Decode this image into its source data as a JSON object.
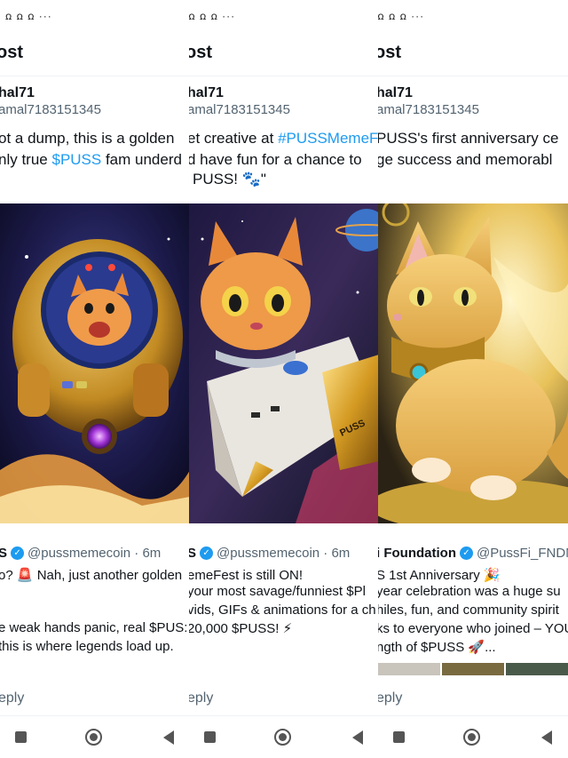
{
  "panels": [
    {
      "status_icons": "ꭥ ꭥ ꭥ ···",
      "header_title": "ost",
      "name": "hal71",
      "handle": "amal7183151345",
      "body_lines": [
        "ot a dump, this is a golden",
        "nly true ",
        "$PUSS",
        " fam underd"
      ],
      "quote_name": "S",
      "quote_handle": "@pussmemecoin · 6m",
      "quote_lines": [
        "o? 🚨 Nah, just another golden",
        "e weak hands panic,  real $PUS:",
        "this is where legends load up."
      ],
      "reply": "eply"
    },
    {
      "status_icons": "✱ ꭥ ꭥ ꭥ ···",
      "header_title": "ost",
      "name": "hal71",
      "handle": "amal7183151345",
      "body_lines": [
        "et creative at ",
        "#PUSSMemeF",
        "d have fun for a chance to",
        "PUSS! 🐾\""
      ],
      "quote_name": "S",
      "quote_handle": "@pussmemecoin · 6m",
      "quote_lines": [
        "emeFest is still ON!",
        "your most savage/funniest $Pl",
        "vids, GIFs & animations for a ch",
        "20,000 $PUSS! ⚡"
      ],
      "reply": "eply"
    },
    {
      "status_icons": "✱ ꭥ ꭥ ꭥ ···",
      "header_title": "ost",
      "name": "hal71",
      "handle": "amal7183151345",
      "body_lines": [
        "PUSS's first anniversary ce",
        "ge success and memorabl"
      ],
      "quote_name": "i Foundation",
      "quote_handle": "@PussFi_FNDN",
      "quote_lines": [
        "S 1st Anniversary 🎉",
        "year celebration was a huge su",
        "hiles, fun, and community spirit",
        "ks to everyone who joined – YOU",
        "ngth of $PUSS 🚀..."
      ],
      "reply": "eply"
    }
  ],
  "colors": {
    "link": "#1d9bf0",
    "secondary_text": "#536471",
    "verified": "#1d9bf0"
  },
  "icons": [
    "bluetooth-icon",
    "signal-icon",
    "verified-badge-icon",
    "nav-recents-icon",
    "nav-home-icon",
    "nav-back-icon"
  ]
}
